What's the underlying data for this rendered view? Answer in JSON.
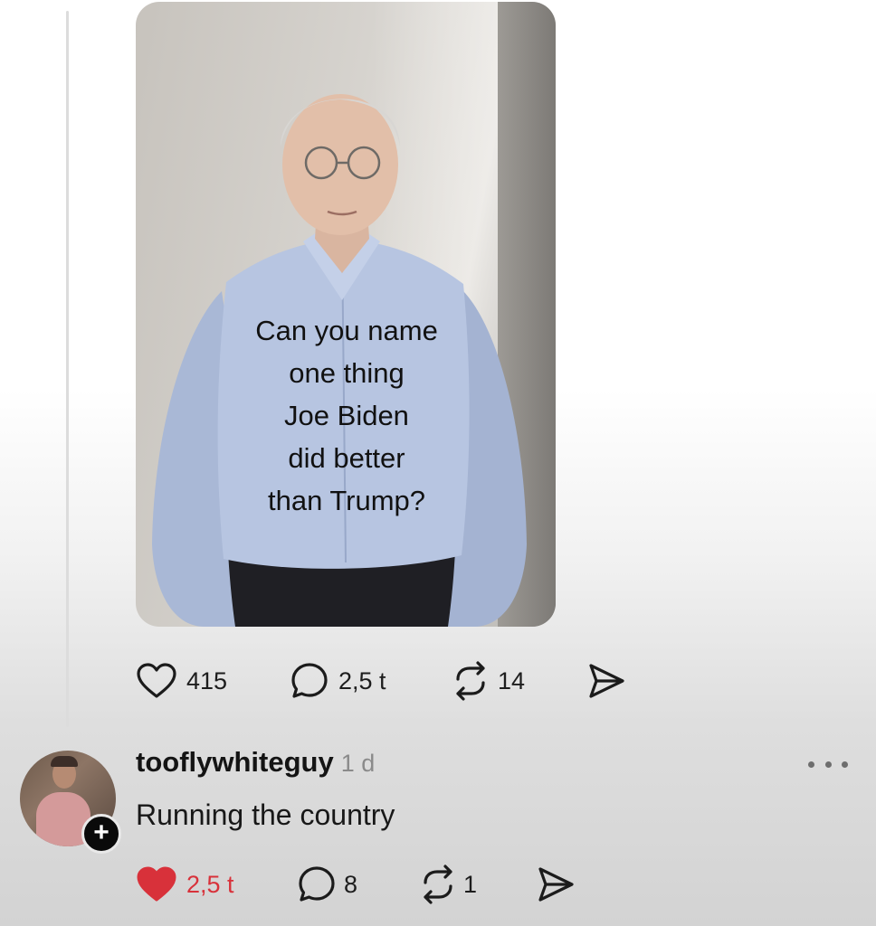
{
  "post": {
    "image_text_lines": [
      "Can you name",
      "one thing",
      "Joe Biden",
      "did better",
      "than Trump?"
    ],
    "stats": {
      "likes": "415",
      "replies": "2,5 t",
      "reposts": "14"
    }
  },
  "reply": {
    "username": "tooflywhiteguy",
    "time": "1 d",
    "text": "Running the country",
    "follow_symbol": "+",
    "liked": true,
    "stats": {
      "likes": "2,5 t",
      "replies": "8",
      "reposts": "1"
    }
  },
  "icons": {
    "like": "heart-icon",
    "liked": "heart-filled-icon",
    "reply": "comment-bubble-icon",
    "repost": "repost-icon",
    "share": "send-icon",
    "more": "more-horizontal-icon"
  },
  "colors": {
    "like_active": "#d8313a",
    "text": "#161616",
    "muted": "#8a8a8a"
  }
}
